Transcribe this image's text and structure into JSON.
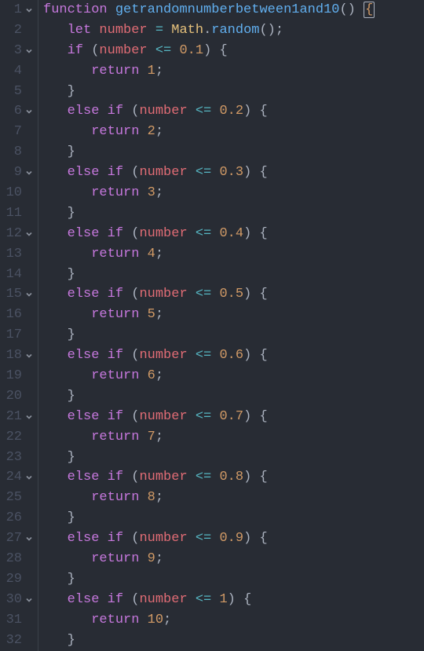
{
  "code": {
    "function_kw": "function",
    "function_name": "getrandomnumber​between1and10",
    "let_kw": "let",
    "var_name": "number",
    "assign_op": "=",
    "math_obj": "Math",
    "random_call": "random",
    "if_kw": "if",
    "else_kw": "else",
    "return_kw": "return",
    "cmp_op": "<=",
    "branches": [
      {
        "threshold": "0.1",
        "result": "1"
      },
      {
        "threshold": "0.2",
        "result": "2"
      },
      {
        "threshold": "0.3",
        "result": "3"
      },
      {
        "threshold": "0.4",
        "result": "4"
      },
      {
        "threshold": "0.5",
        "result": "5"
      },
      {
        "threshold": "0.6",
        "result": "6"
      },
      {
        "threshold": "0.7",
        "result": "7"
      },
      {
        "threshold": "0.8",
        "result": "8"
      },
      {
        "threshold": "0.9",
        "result": "9"
      },
      {
        "threshold": "1",
        "result": "10"
      }
    ]
  },
  "gutter": {
    "lines": [
      {
        "n": "1",
        "fold": true
      },
      {
        "n": "2",
        "fold": false
      },
      {
        "n": "3",
        "fold": true
      },
      {
        "n": "4",
        "fold": false
      },
      {
        "n": "5",
        "fold": false
      },
      {
        "n": "6",
        "fold": true
      },
      {
        "n": "7",
        "fold": false
      },
      {
        "n": "8",
        "fold": false
      },
      {
        "n": "9",
        "fold": true
      },
      {
        "n": "10",
        "fold": false
      },
      {
        "n": "11",
        "fold": false
      },
      {
        "n": "12",
        "fold": true
      },
      {
        "n": "13",
        "fold": false
      },
      {
        "n": "14",
        "fold": false
      },
      {
        "n": "15",
        "fold": true
      },
      {
        "n": "16",
        "fold": false
      },
      {
        "n": "17",
        "fold": false
      },
      {
        "n": "18",
        "fold": true
      },
      {
        "n": "19",
        "fold": false
      },
      {
        "n": "20",
        "fold": false
      },
      {
        "n": "21",
        "fold": true
      },
      {
        "n": "22",
        "fold": false
      },
      {
        "n": "23",
        "fold": false
      },
      {
        "n": "24",
        "fold": true
      },
      {
        "n": "25",
        "fold": false
      },
      {
        "n": "26",
        "fold": false
      },
      {
        "n": "27",
        "fold": true
      },
      {
        "n": "28",
        "fold": false
      },
      {
        "n": "29",
        "fold": false
      },
      {
        "n": "30",
        "fold": true
      },
      {
        "n": "31",
        "fold": false
      },
      {
        "n": "32",
        "fold": false
      }
    ]
  }
}
